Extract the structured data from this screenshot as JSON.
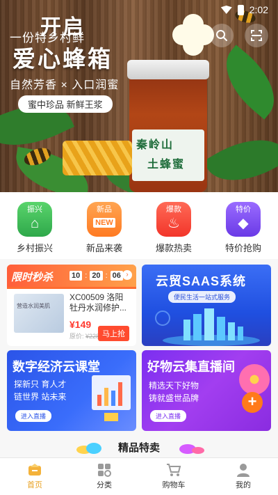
{
  "status_bar": {
    "time": "2:02"
  },
  "hero": {
    "title_top": "开启",
    "subtitle": "一份特乡村鲜",
    "title_main": "爱心蜂箱",
    "tagline": "自然芳香 × 入口润蜜",
    "pill": "蜜中珍品 新鲜王浆",
    "jar_label_line1": "秦岭山",
    "jar_label_line2": "土蜂蜜"
  },
  "categories": [
    {
      "badge": "振兴",
      "glyph": "⌂",
      "label": "乡村振兴",
      "color": "#3ec25a"
    },
    {
      "badge": "新品",
      "glyph": "NEW",
      "label": "新品来袭",
      "color": "#ff8a2a"
    },
    {
      "badge": "爆款",
      "glyph": "♨",
      "label": "爆款热卖",
      "color": "#ff4a3a"
    },
    {
      "badge": "特价",
      "glyph": "◆",
      "label": "特价抢购",
      "color": "#7a4ef0"
    }
  ],
  "flash_sale": {
    "tag": "限时秒杀",
    "timer": [
      "10",
      "20",
      "06"
    ],
    "product_thumb_text": "营造水润美肌",
    "product_name": "XC00509 洛阳牡丹水润修护...",
    "price": "¥149",
    "original_price_label": "原价: ",
    "original_price": "¥228",
    "buy_label": "马上抢",
    "more_icon": "chevron-right-icon"
  },
  "saas_card": {
    "title": "云贸SAAS系统",
    "pill": "便民生活一站式服务"
  },
  "cloud_class": {
    "title": "数字经济云课堂",
    "line1": "探新只 育人才",
    "line2": "链世界 站未来",
    "button": "进入直播"
  },
  "live_card": {
    "title": "好物云集直播间",
    "line1": "精选天下好物",
    "line2": "铸就盛世品牌",
    "button": "进入直播",
    "plus": "+"
  },
  "section_title": "精品特卖",
  "tabbar": [
    {
      "label": "首页",
      "icon": "home-icon",
      "active": true
    },
    {
      "label": "分类",
      "icon": "grid-icon",
      "active": false
    },
    {
      "label": "购物车",
      "icon": "cart-icon",
      "active": false
    },
    {
      "label": "我的",
      "icon": "user-icon",
      "active": false
    }
  ]
}
